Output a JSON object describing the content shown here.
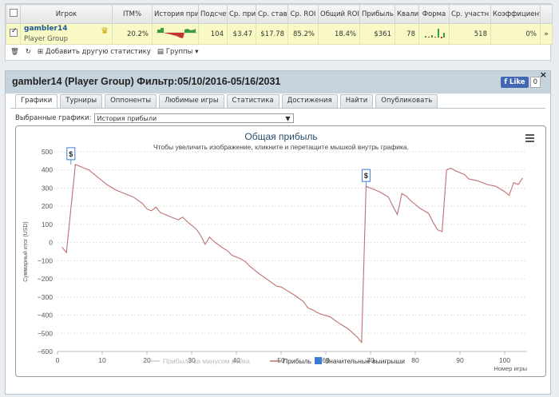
{
  "stats": {
    "columns": [
      "",
      "Игрок",
      "ITM%",
      "История приб",
      "Подсчет",
      "Ср. приб",
      "Ср. ставк",
      "Ср. ROI",
      "Общий ROI",
      "Прибыль",
      "Квали",
      "Форма",
      "Ср. участн",
      "Коэффициент",
      ""
    ],
    "row": {
      "player": "gambler14",
      "group": "Player Group",
      "itm": "20.2%",
      "count": "104",
      "avg_profit": "$3.47",
      "avg_stake": "$17.78",
      "avg_roi": "85.2%",
      "total_roi": "18.4%",
      "profit": "$361",
      "quali": "78",
      "avg_entrants": "518",
      "coefficient": "0%",
      "expand": "»"
    },
    "colors": {
      "row_bg": "#f9f9c6",
      "spark_pos": "#3c9b3c",
      "spark_neg": "#c83232"
    }
  },
  "toolbar": {
    "add_stats": "Добавить другую статистику",
    "groups": "Группы"
  },
  "main": {
    "title": "gambler14 (Player Group) Фильтр:05/10/2016-05/16/2031",
    "fb_like": "Like",
    "fb_count": "0",
    "close": "×",
    "tabs": [
      "Графики",
      "Турниры",
      "Оппоненты",
      "Любимые игры",
      "Статистика",
      "Достижения",
      "Найти",
      "Опубликовать"
    ],
    "active_tab": 0,
    "select_label": "Выбранные графики:",
    "select_value": "История прибыли"
  },
  "chart_data": {
    "type": "line",
    "title": "Общая прибыль",
    "subtitle": "Чтобы увеличить изображение, кликните и перетащите мышкой внутрь графика.",
    "xlabel": "Номер игры",
    "ylabel": "Суммарный итог (USD)",
    "xlim": [
      0,
      105
    ],
    "ylim": [
      -600,
      500
    ],
    "xticks": [
      0,
      10,
      20,
      30,
      40,
      50,
      60,
      70,
      80,
      90,
      100
    ],
    "yticks": [
      500,
      400,
      300,
      200,
      100,
      0,
      -100,
      -200,
      -300,
      -400,
      -500,
      -600
    ],
    "grid": true,
    "legend_position": "bottom",
    "series": [
      {
        "name": "Прибыль за минусом рейка",
        "color": "#d0d0d0",
        "values": []
      },
      {
        "name": "Прибыль",
        "color": "#c07070",
        "x": [
          1,
          2,
          4,
          5,
          7,
          9,
          11,
          13,
          15,
          17,
          19,
          20,
          21,
          22,
          23,
          24,
          25,
          27,
          28,
          29,
          31,
          32,
          33,
          34,
          35,
          37,
          38,
          39,
          41,
          42,
          43,
          45,
          47,
          49,
          50,
          51,
          53,
          55,
          56,
          57,
          58,
          59,
          61,
          63,
          65,
          67,
          68,
          69,
          70,
          72,
          74,
          75,
          76,
          77,
          78,
          79,
          80,
          81,
          83,
          84,
          85,
          86,
          87,
          88,
          89,
          91,
          92,
          94,
          96,
          98,
          100,
          101,
          102,
          103,
          104
        ],
        "y": [
          -25,
          -55,
          430,
          420,
          400,
          360,
          320,
          290,
          270,
          250,
          215,
          185,
          175,
          195,
          165,
          155,
          145,
          125,
          140,
          115,
          75,
          40,
          -10,
          30,
          5,
          -30,
          -45,
          -70,
          -90,
          -105,
          -130,
          -170,
          -205,
          -240,
          -245,
          -260,
          -290,
          -325,
          -360,
          -370,
          -385,
          -395,
          -410,
          -445,
          -475,
          -520,
          -550,
          310,
          300,
          280,
          250,
          200,
          155,
          270,
          255,
          230,
          210,
          190,
          160,
          110,
          70,
          60,
          400,
          410,
          395,
          375,
          350,
          340,
          320,
          310,
          280,
          260,
          330,
          320,
          355
        ]
      },
      {
        "name": "Значительные выигрыши",
        "color": "#3a7bd5",
        "type": "flag",
        "x": [
          3,
          69
        ],
        "y": [
          430,
          310
        ],
        "labels": [
          "$",
          "$"
        ]
      }
    ]
  }
}
